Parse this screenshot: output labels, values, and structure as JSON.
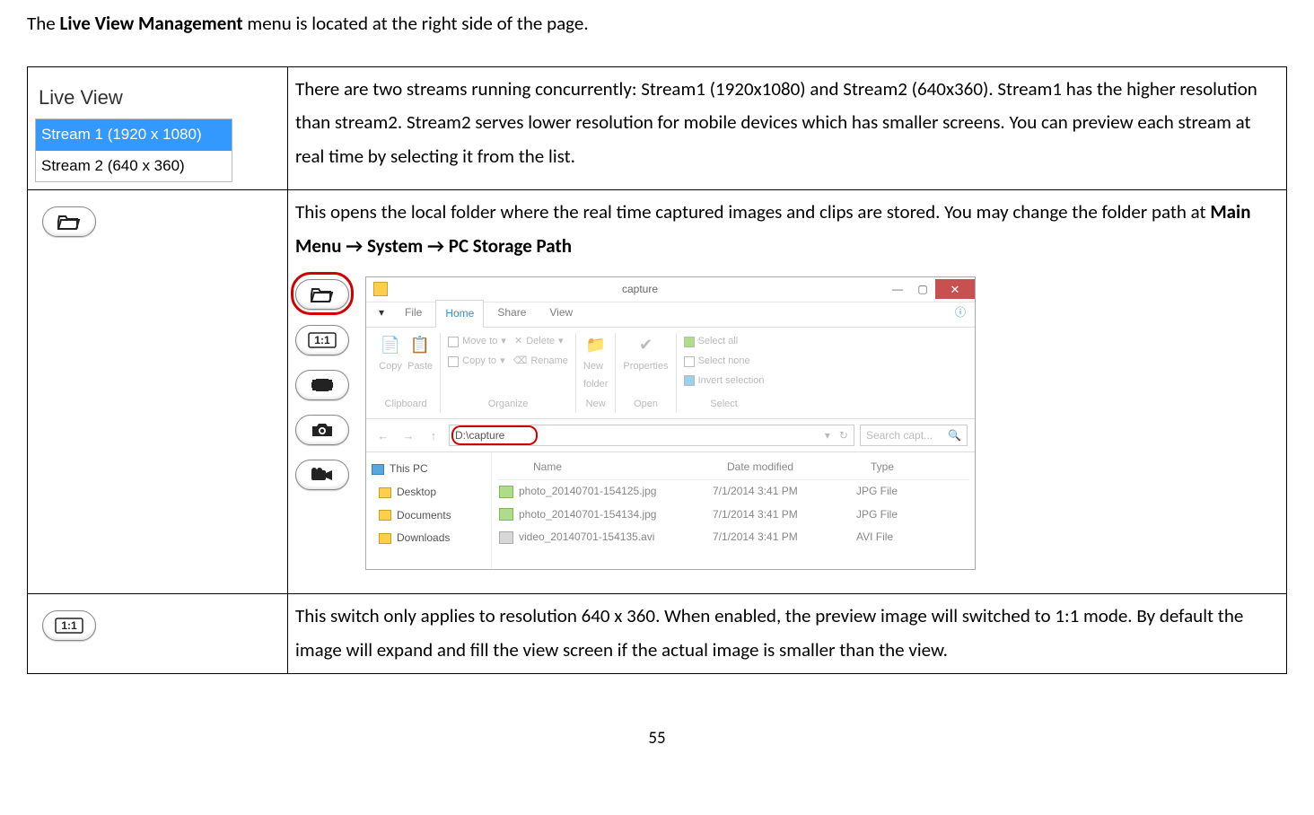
{
  "intro": {
    "prefix": "The ",
    "bold": "Live View Management",
    "suffix": " menu is located at the right side of the page."
  },
  "row1": {
    "header": "Live View",
    "stream1": "Stream 1 (1920 x 1080)",
    "stream2": "Stream 2 (640 x 360)",
    "desc": "There are two streams running concurrently: Stream1 (1920x1080) and Stream2 (640x360). Stream1 has the higher resolution than stream2. Stream2 serves lower resolution for mobile devices which has smaller screens. You can preview each stream at real time by selecting it from the list."
  },
  "row2": {
    "desc_prefix": "This opens the local folder where the real time captured images and clips are stored. You may change the folder path at ",
    "bold1": "Main Menu",
    "arrow": " → ",
    "bold2": "System",
    "bold3": "PC Storage Path"
  },
  "row3": {
    "desc": "This switch only applies to resolution 640 x 360. When enabled, the preview image will switched to 1:1 mode. By default the image will expand and fill the view screen if the actual image is smaller than the view."
  },
  "explorer": {
    "title": "capture",
    "tabs": {
      "file": "File",
      "home": "Home",
      "share": "Share",
      "view": "View"
    },
    "ribbon": {
      "copy": "Copy",
      "paste": "Paste",
      "clipboard": "Clipboard",
      "moveto": "Move to",
      "copyto": "Copy to",
      "delete": "Delete",
      "rename": "Rename",
      "organize": "Organize",
      "newfolder": "New\nfolder",
      "new": "New",
      "properties": "Properties",
      "open": "Open",
      "selectall": "Select all",
      "selectnone": "Select none",
      "invert": "Invert selection",
      "select": "Select"
    },
    "path": "D:\\capture",
    "search": "Search capt...",
    "tree": {
      "thispc": "This PC",
      "desktop": "Desktop",
      "documents": "Documents",
      "downloads": "Downloads"
    },
    "columns": {
      "name": "Name",
      "date": "Date modified",
      "type": "Type"
    },
    "files": [
      {
        "name": "photo_20140701-154125.jpg",
        "date": "7/1/2014 3:41 PM",
        "type": "JPG File",
        "kind": "img"
      },
      {
        "name": "photo_20140701-154134.jpg",
        "date": "7/1/2014 3:41 PM",
        "type": "JPG File",
        "kind": "img"
      },
      {
        "name": "video_20140701-154135.avi",
        "date": "7/1/2014 3:41 PM",
        "type": "AVI File",
        "kind": "vid"
      }
    ]
  },
  "page": "55"
}
